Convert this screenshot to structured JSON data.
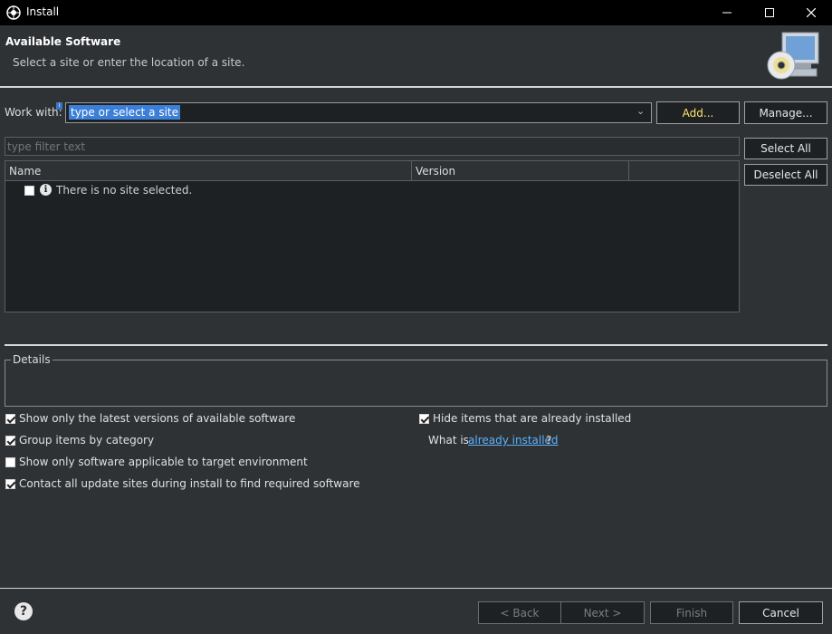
{
  "window": {
    "title": "Install",
    "controls": [
      "minimize-icon",
      "maximize-icon",
      "close-icon"
    ]
  },
  "header": {
    "title": "Available Software",
    "description": "Select a site or enter the location of a site."
  },
  "work_with": {
    "label": "Work with:",
    "value": "type or select a site",
    "add_label": "Add...",
    "manage_label": "Manage..."
  },
  "filter": {
    "placeholder": "type filter text"
  },
  "selection": {
    "select_all_label": "Select All",
    "deselect_all_label": "Deselect All"
  },
  "table": {
    "columns": [
      "Name",
      "Version",
      ""
    ],
    "rows": [
      {
        "checked": false,
        "icon": "info-icon",
        "text": "There is no site selected."
      }
    ]
  },
  "details": {
    "label": "Details"
  },
  "options": {
    "latest_versions": {
      "label": "Show only the latest versions of available software",
      "checked": true
    },
    "group_by_category": {
      "label": "Group items by category",
      "checked": true
    },
    "target_env": {
      "label": "Show only software applicable to target environment",
      "checked": false
    },
    "contact_sites": {
      "label": "Contact all update sites during install to find required software",
      "checked": true
    },
    "hide_installed": {
      "label": "Hide items that are already installed",
      "checked": true
    },
    "what_is_prefix": "What is ",
    "what_is_link": "already installed",
    "what_is_suffix": "?"
  },
  "footer": {
    "back_label": "< Back",
    "next_label": "Next >",
    "finish_label": "Finish",
    "cancel_label": "Cancel"
  },
  "colors": {
    "background": "#2f3235",
    "accent_selection": "#3c7fd8",
    "link": "#5ab3ff",
    "add_highlight": "#ffe36b"
  }
}
